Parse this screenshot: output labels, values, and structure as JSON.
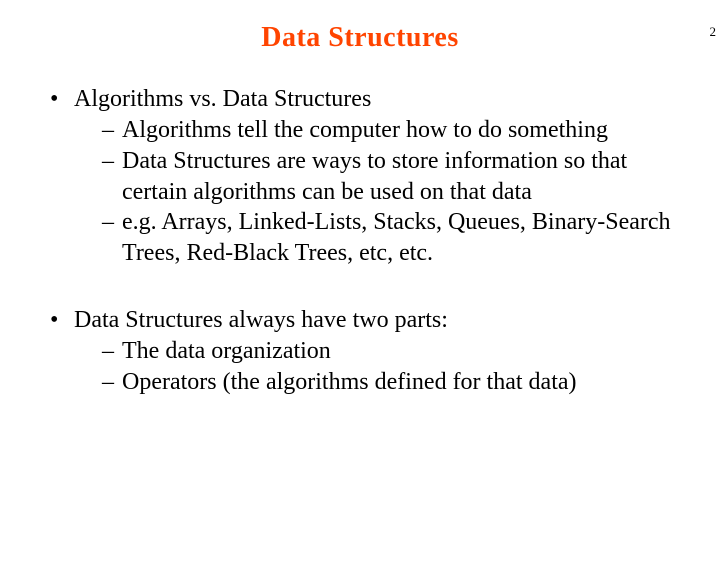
{
  "page_number": "2",
  "title": "Data  Structures",
  "sections": [
    {
      "heading": "Algorithms vs. Data Structures",
      "items": [
        "Algorithms tell the computer how to do something",
        "Data Structures are ways to store information so that certain algorithms can be used on that data",
        "e.g. Arrays, Linked-Lists, Stacks, Queues, Binary-Search Trees, Red-Black Trees, etc, etc."
      ]
    },
    {
      "heading": "Data Structures always have two parts:",
      "items": [
        "The data organization",
        "Operators (the algorithms defined for that data)"
      ]
    }
  ]
}
